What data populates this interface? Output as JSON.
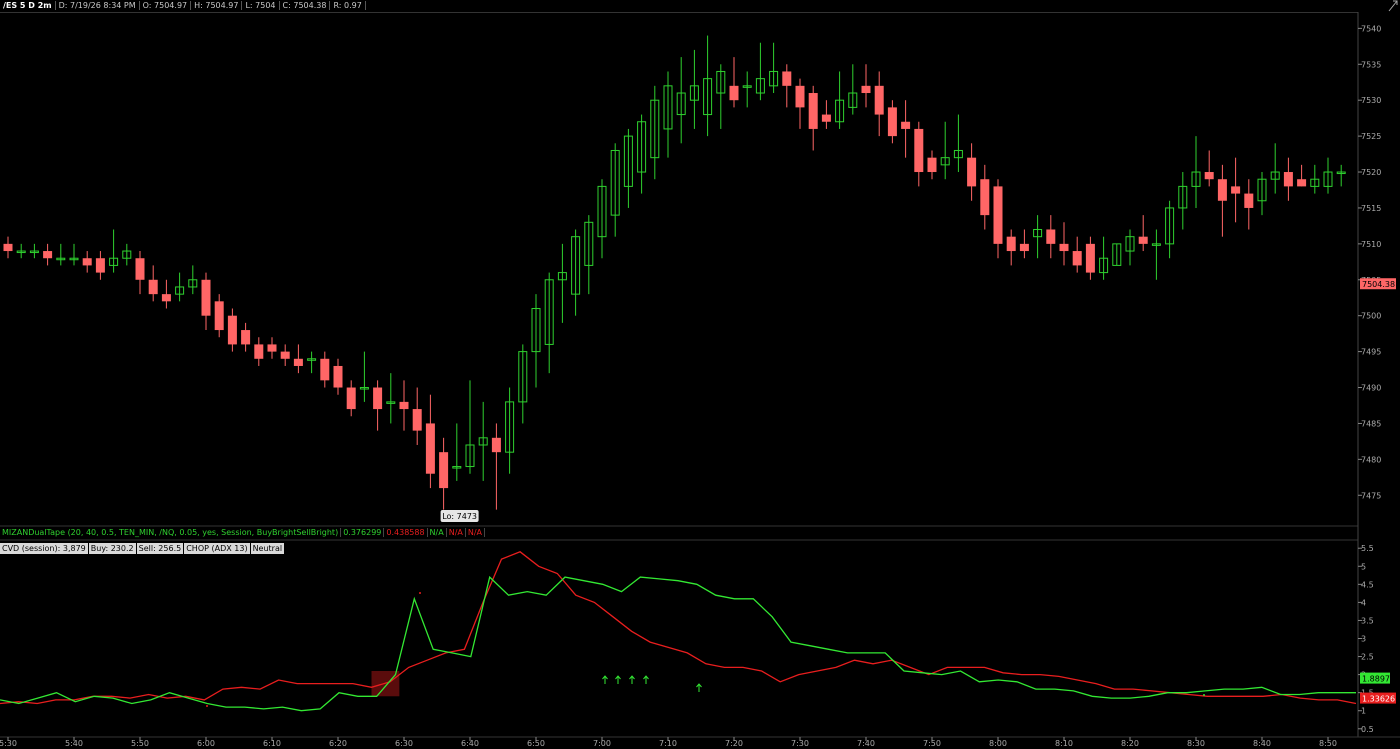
{
  "header": {
    "symbol": "/ES 5 D 2m",
    "date": "D: 7/19/26 8:34 PM",
    "open": "O: 7504.97",
    "high": "H: 7504.97",
    "low": "L: 7504",
    "close": "C: 7504.38",
    "range": "R: 0.97",
    "corner_icon": "expand-icon"
  },
  "colors": {
    "up": "#2fd12f",
    "down": "#ff6666",
    "cvd_green": "#33e833",
    "cvd_red": "#e81e1e",
    "background": "#000000"
  },
  "price_axis": {
    "ticks": [
      "7540",
      "7535",
      "7530",
      "7525",
      "7520",
      "7515",
      "7510",
      "7505",
      "7500",
      "7495",
      "7490",
      "7485",
      "7480",
      "7475"
    ],
    "current_price": "7504.38",
    "low_label": "Lo: 7473",
    "range": [
      7471,
      7542
    ]
  },
  "lower_axis": {
    "ticks": [
      "5.5",
      "5",
      "4.5",
      "4",
      "3.5",
      "3",
      "2.5",
      "2",
      "1.5",
      "1",
      "0.5"
    ],
    "green_value": "1.8897",
    "red_value": "1.33626",
    "range": [
      0.3,
      5.7
    ]
  },
  "time_axis": [
    "5:30",
    "5:40",
    "5:50",
    "6:00",
    "6:10",
    "6:20",
    "6:30",
    "6:40",
    "6:50",
    "7:00",
    "7:10",
    "7:20",
    "7:30",
    "7:40",
    "7:50",
    "8:00",
    "8:10",
    "8:20",
    "8:30",
    "8:40",
    "8:50"
  ],
  "study": {
    "label": "MIZANDualTape (20, 40, 0.5, TEN_MIN, /NQ, 0.05, yes, Session, BuyBrightSellBright)",
    "val1": "0.376299",
    "val2": "0.438588",
    "na1": "N/A",
    "na2": "N/A",
    "na3": "N/A"
  },
  "info": {
    "cvd": "CVD (session): 3,879",
    "buy": "Buy: 230.2",
    "sell": "Sell: 256.5",
    "chop": "CHOP (ADX 13)",
    "state": "Neutral"
  },
  "chart_data": [
    {
      "type": "candlestick",
      "interval": "2m",
      "start_time": "5:30",
      "candles": [
        [
          7510,
          7511,
          7508,
          7509
        ],
        [
          7509,
          7510,
          7508,
          7509
        ],
        [
          7509,
          7510,
          7508,
          7509
        ],
        [
          7509,
          7510,
          7507,
          7508
        ],
        [
          7508,
          7510,
          7507,
          7508
        ],
        [
          7508,
          7510,
          7507,
          7508
        ],
        [
          7508,
          7509,
          7506,
          7507
        ],
        [
          7508,
          7509,
          7505,
          7506
        ],
        [
          7507,
          7512,
          7506,
          7508
        ],
        [
          7508,
          7510,
          7507,
          7509
        ],
        [
          7508,
          7509,
          7503,
          7505
        ],
        [
          7505,
          7507,
          7502,
          7503
        ],
        [
          7503,
          7505,
          7501,
          7502
        ],
        [
          7503,
          7506,
          7502,
          7504
        ],
        [
          7504,
          7507,
          7503,
          7505
        ],
        [
          7505,
          7506,
          7498,
          7500
        ],
        [
          7502,
          7503,
          7497,
          7498
        ],
        [
          7500,
          7501,
          7495,
          7496
        ],
        [
          7498,
          7499,
          7495,
          7496
        ],
        [
          7496,
          7497,
          7493,
          7494
        ],
        [
          7496,
          7497,
          7494,
          7495
        ],
        [
          7495,
          7496,
          7493,
          7494
        ],
        [
          7494,
          7496,
          7492,
          7493
        ],
        [
          7494,
          7495,
          7492,
          7494
        ],
        [
          7494,
          7495,
          7490,
          7491
        ],
        [
          7493,
          7494,
          7489,
          7490
        ],
        [
          7490,
          7491,
          7486,
          7487
        ],
        [
          7490,
          7495,
          7488,
          7490
        ],
        [
          7490,
          7491,
          7484,
          7487
        ],
        [
          7488,
          7492,
          7485,
          7488
        ],
        [
          7488,
          7491,
          7484,
          7487
        ],
        [
          7487,
          7490,
          7482,
          7484
        ],
        [
          7485,
          7489,
          7476,
          7478
        ],
        [
          7481,
          7483,
          7473,
          7476
        ],
        [
          7479,
          7485,
          7477,
          7479
        ],
        [
          7479,
          7491,
          7478,
          7482
        ],
        [
          7482,
          7488,
          7477,
          7483
        ],
        [
          7483,
          7485,
          7473,
          7481
        ],
        [
          7481,
          7490,
          7478,
          7488
        ],
        [
          7488,
          7496,
          7485,
          7495
        ],
        [
          7495,
          7503,
          7490,
          7501
        ],
        [
          7496,
          7506,
          7492,
          7505
        ],
        [
          7505,
          7510,
          7499,
          7506
        ],
        [
          7503,
          7512,
          7500,
          7511
        ],
        [
          7507,
          7514,
          7503,
          7513
        ],
        [
          7511,
          7519,
          7508,
          7518
        ],
        [
          7514,
          7524,
          7511,
          7523
        ],
        [
          7518,
          7526,
          7515,
          7525
        ],
        [
          7520,
          7528,
          7517,
          7527
        ],
        [
          7522,
          7532,
          7519,
          7530
        ],
        [
          7526,
          7534,
          7522,
          7532
        ],
        [
          7528,
          7536,
          7524,
          7531
        ],
        [
          7530,
          7537,
          7526,
          7532
        ],
        [
          7528,
          7539,
          7525,
          7533
        ],
        [
          7531,
          7535,
          7526,
          7534
        ],
        [
          7532,
          7536,
          7529,
          7530
        ],
        [
          7532,
          7534,
          7529,
          7532
        ],
        [
          7531,
          7538,
          7530,
          7533
        ],
        [
          7532,
          7538,
          7531,
          7534
        ],
        [
          7534,
          7535,
          7529,
          7532
        ],
        [
          7532,
          7533,
          7526,
          7529
        ],
        [
          7531,
          7532,
          7523,
          7526
        ],
        [
          7528,
          7530,
          7526,
          7527
        ],
        [
          7527,
          7534,
          7526,
          7530
        ],
        [
          7529,
          7535,
          7528,
          7531
        ],
        [
          7532,
          7535,
          7529,
          7531
        ],
        [
          7532,
          7534,
          7525,
          7528
        ],
        [
          7529,
          7530,
          7524,
          7525
        ],
        [
          7527,
          7530,
          7522,
          7526
        ],
        [
          7526,
          7527,
          7518,
          7520
        ],
        [
          7522,
          7523,
          7519,
          7520
        ],
        [
          7521,
          7527,
          7519,
          7522
        ],
        [
          7522,
          7528,
          7520,
          7523
        ],
        [
          7522,
          7524,
          7516,
          7518
        ],
        [
          7519,
          7521,
          7512,
          7514
        ],
        [
          7518,
          7519,
          7508,
          7510
        ],
        [
          7511,
          7512,
          7507,
          7509
        ],
        [
          7510,
          7512,
          7508,
          7509
        ],
        [
          7511,
          7514,
          7508,
          7512
        ],
        [
          7512,
          7514,
          7508,
          7510
        ],
        [
          7510,
          7513,
          7507,
          7509
        ],
        [
          7509,
          7511,
          7506,
          7507
        ],
        [
          7510,
          7511,
          7505,
          7506
        ],
        [
          7506,
          7511,
          7505,
          7508
        ],
        [
          7507,
          7510,
          7507,
          7510
        ],
        [
          7509,
          7512,
          7507,
          7511
        ],
        [
          7511,
          7514,
          7509,
          7510
        ],
        [
          7510,
          7512,
          7505,
          7510
        ],
        [
          7510,
          7516,
          7508,
          7515
        ],
        [
          7515,
          7520,
          7512,
          7518
        ],
        [
          7518,
          7525,
          7515,
          7520
        ],
        [
          7520,
          7523,
          7518,
          7519
        ],
        [
          7519,
          7521,
          7511,
          7516
        ],
        [
          7518,
          7522,
          7513,
          7517
        ],
        [
          7517,
          7519,
          7512,
          7515
        ],
        [
          7516,
          7520,
          7514,
          7519
        ],
        [
          7519,
          7524,
          7517,
          7520
        ],
        [
          7520,
          7522,
          7516,
          7518
        ],
        [
          7519,
          7521,
          7518,
          7518
        ],
        [
          7518,
          7521,
          7517,
          7519
        ],
        [
          7518,
          7522,
          7517,
          7520
        ],
        [
          7520,
          7521,
          7518,
          7520
        ]
      ]
    },
    {
      "type": "line",
      "series": [
        {
          "values": [
            1.3,
            1.2,
            1.35,
            1.5,
            1.25,
            1.4,
            1.35,
            1.2,
            1.3,
            1.5,
            1.35,
            1.2,
            1.1,
            1.1,
            1.05,
            1.1,
            1.0,
            1.05,
            1.5,
            1.4,
            1.4,
            2.0,
            4.1,
            2.7,
            2.6,
            2.5,
            4.7,
            4.2,
            4.3,
            4.2,
            4.7,
            4.6,
            4.5,
            4.3,
            4.7,
            4.65,
            4.6,
            4.5,
            4.2,
            4.1,
            4.1,
            3.6,
            2.9,
            2.8,
            2.7,
            2.6,
            2.6,
            2.6,
            2.1,
            2.05,
            2.0,
            2.1,
            1.8,
            1.85,
            1.8,
            1.6,
            1.6,
            1.55,
            1.4,
            1.35,
            1.35,
            1.4,
            1.5,
            1.5,
            1.55,
            1.6,
            1.6,
            1.65,
            1.45,
            1.45,
            1.5,
            1.5,
            1.5
          ]
        },
        {
          "values": [
            1.2,
            1.25,
            1.2,
            1.3,
            1.3,
            1.4,
            1.4,
            1.35,
            1.45,
            1.35,
            1.4,
            1.3,
            1.6,
            1.65,
            1.6,
            1.85,
            1.75,
            1.75,
            1.75,
            1.75,
            1.65,
            1.8,
            2.2,
            2.4,
            2.6,
            2.7,
            4.0,
            5.2,
            5.4,
            5.0,
            4.8,
            4.2,
            4.0,
            3.6,
            3.2,
            2.9,
            2.75,
            2.6,
            2.3,
            2.2,
            2.2,
            2.1,
            1.8,
            2.0,
            2.1,
            2.2,
            2.4,
            2.3,
            2.4,
            2.2,
            2.0,
            2.2,
            2.2,
            2.2,
            2.05,
            2.0,
            2.0,
            1.95,
            1.85,
            1.75,
            1.6,
            1.6,
            1.55,
            1.5,
            1.45,
            1.4,
            1.4,
            1.4,
            1.4,
            1.45,
            1.35,
            1.3,
            1.3,
            1.2
          ]
        }
      ],
      "range": [
        0.3,
        5.7
      ]
    }
  ]
}
